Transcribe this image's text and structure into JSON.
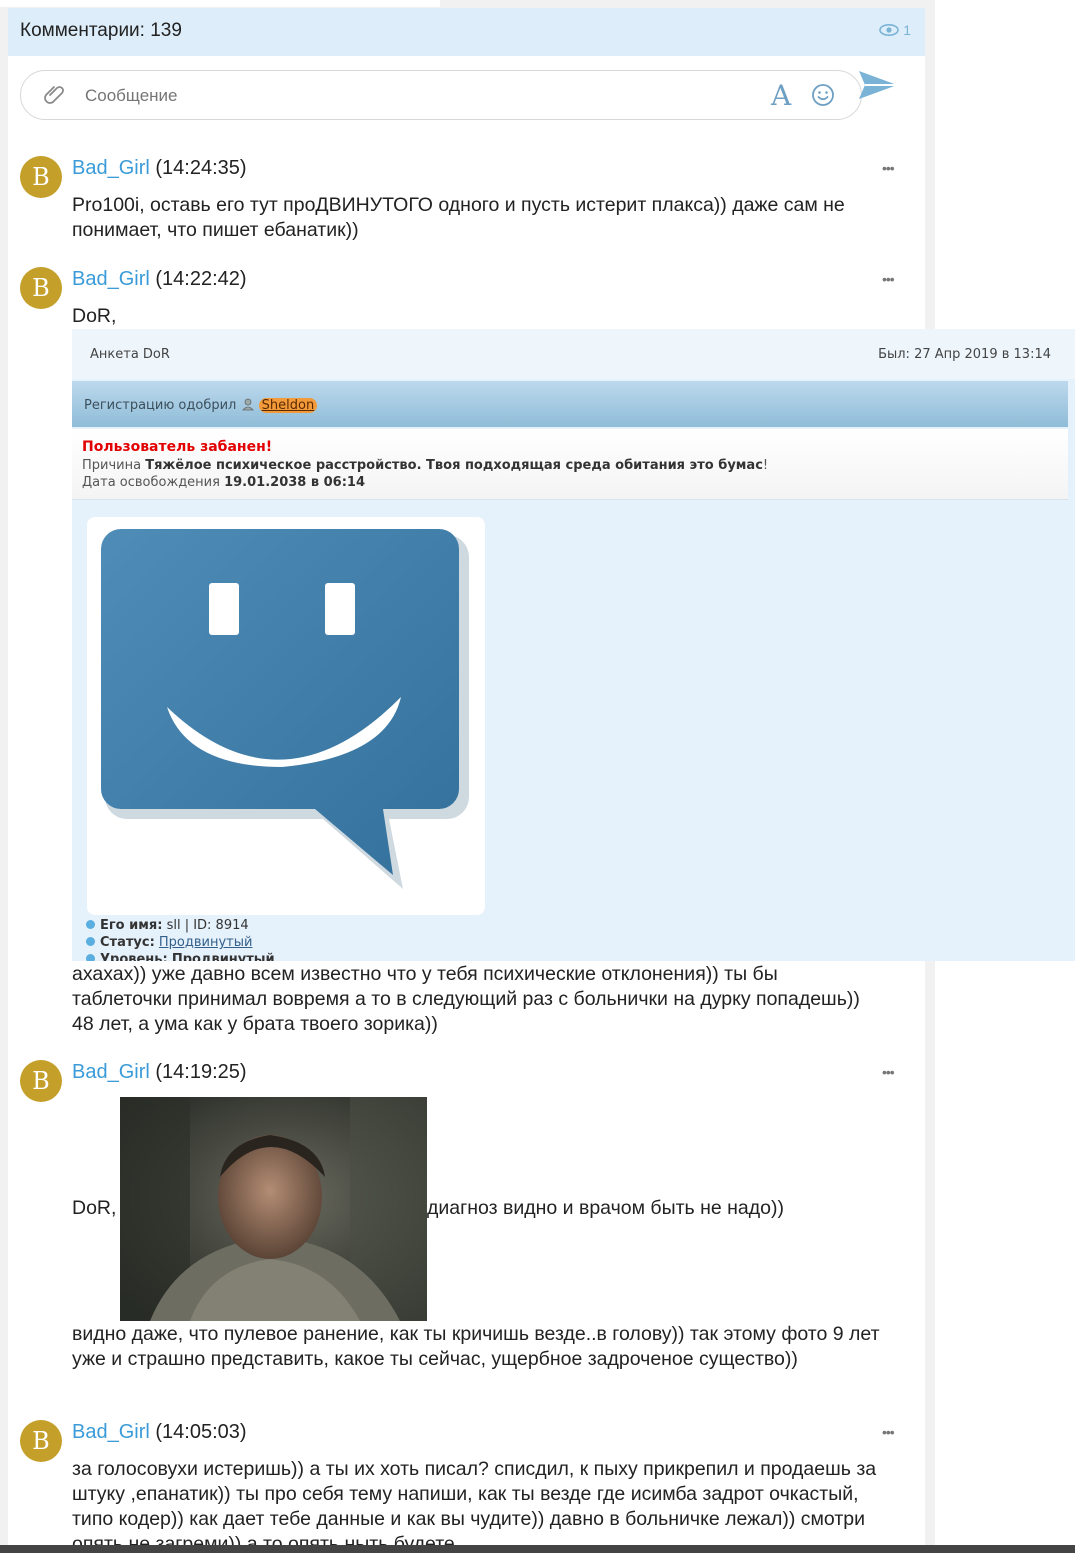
{
  "header": {
    "title": "Комментарии: 139",
    "views_count": "1"
  },
  "composer": {
    "placeholder": "Сообщение",
    "format_icon": "A"
  },
  "comments": [
    {
      "avatar_letter": "B",
      "author": "Bad_Girl",
      "time": "(14:24:35)",
      "text": "Pro100i, оставь его тут проДВИНУТОГО одного и пусть истерит плакса)) даже сам не понимает, что пишет ебанатик))"
    },
    {
      "avatar_letter": "B",
      "author": "Bad_Girl",
      "time": "(14:22:42)",
      "text_before": "DoR,",
      "text_after": "ахахах)) уже давно всем известно что у тебя психические отклонения)) ты бы таблеточки принимал вовремя а то в следующий раз с больнички на дурку попадешь)) 48 лет, а ума как у брата твоего зорика))"
    },
    {
      "avatar_letter": "B",
      "author": "Bad_Girl",
      "time": "(14:19:25)",
      "text_before": "DoR,",
      "text_inline": "диагноз видно и врачом быть не надо))",
      "text_after": "видно даже, что пулевое ранение, как ты кричишь везде..в голову)) так этому фото 9 лет уже и страшно представить, какое ты сейчас, ущербное задроченое существо))"
    },
    {
      "avatar_letter": "B",
      "author": "Bad_Girl",
      "time": "(14:05:03)",
      "text": "за голосовухи истеришь)) а ты их хоть писал? списдил, к пыху прикрепил и продаешь за штуку ,епанатик)) ты про себя тему напиши, как ты везде где исимба задрот очкастый, типо кодер)) как дает тебе данные и как вы чудите)) давно в больничке лежал)) смотри опять не загреми)) а то опять ныть будете"
    }
  ],
  "profile": {
    "title": "Анкета DoR",
    "last_seen": "Был: 27 Апр 2019 в 13:14",
    "reg_label": "Регистрацию одобрил",
    "reg_user": "Sheldon",
    "ban_title": "Пользователь забанен!",
    "ban_reason_label": "Причина",
    "ban_reason": "Тяжёлое психическое расстройство. Твоя подходящая среда обитания это бумас",
    "ban_reason_end": "!",
    "ban_date_label": "Дата освобождения",
    "ban_date": "19.01.2038 в 06:14",
    "name_label": "Его имя:",
    "name_value": "sll | ID: 8914",
    "status_label": "Статус:",
    "status_value": "Продвинутый",
    "level_label": "Уровень:",
    "level_value": "Продвинутый"
  },
  "colors": {
    "accent": "#3a9bd8",
    "avatar_bg": "#c4a02a",
    "header_bg": "#ddeefa",
    "ban_red": "#e20000"
  }
}
